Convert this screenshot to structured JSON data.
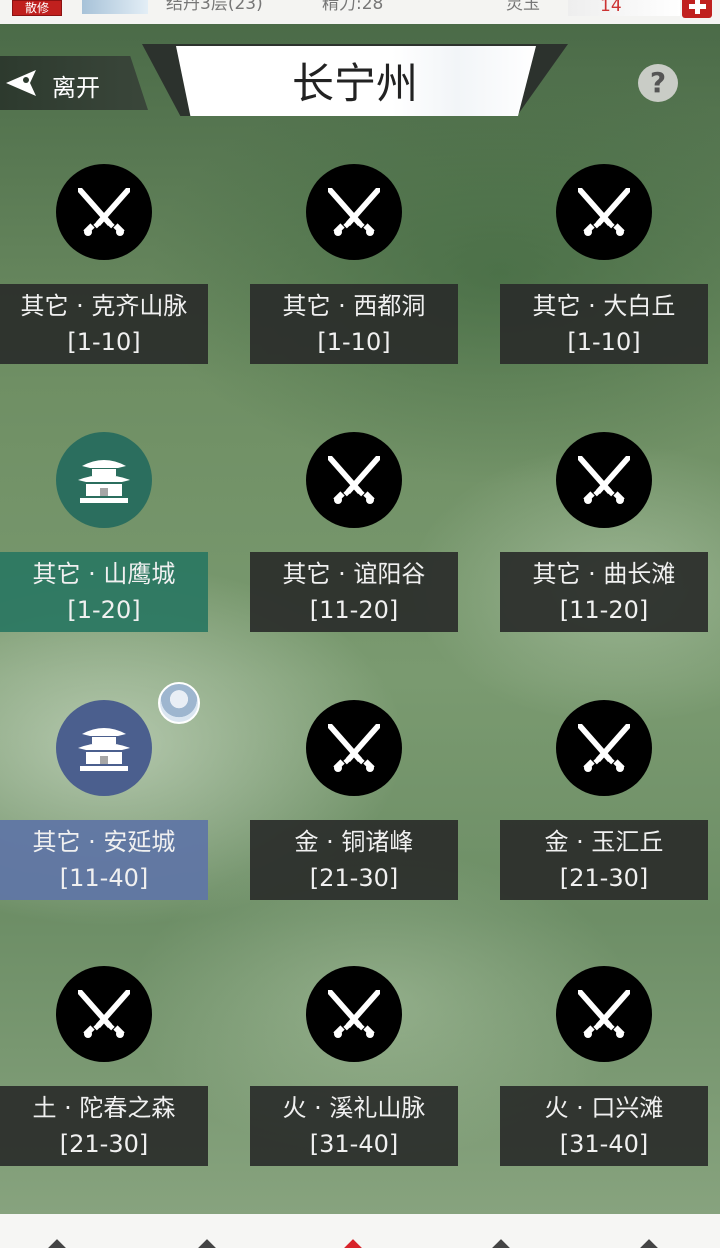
{
  "topbar": {
    "rank": "散修",
    "cultivation": "结丹3层(23)",
    "stamina": "精力:28",
    "jade_label": "灵玉",
    "jade_value": "14"
  },
  "header": {
    "leave_label": "离开",
    "title": "长宁州",
    "help": "?"
  },
  "locations": [
    {
      "name": "其它 · 克齐山脉",
      "range": "[1-10]",
      "type": "battle"
    },
    {
      "name": "其它 · 西都洞",
      "range": "[1-10]",
      "type": "battle"
    },
    {
      "name": "其它 · 大白丘",
      "range": "[1-10]",
      "type": "battle"
    },
    {
      "name": "其它 · 山鹰城",
      "range": "[1-20]",
      "type": "city-green"
    },
    {
      "name": "其它 · 谊阳谷",
      "range": "[11-20]",
      "type": "battle"
    },
    {
      "name": "其它 · 曲长滩",
      "range": "[11-20]",
      "type": "battle"
    },
    {
      "name": "其它 · 安延城",
      "range": "[11-40]",
      "type": "city-blue"
    },
    {
      "name": "金 · 铜诸峰",
      "range": "[21-30]",
      "type": "battle"
    },
    {
      "name": "金 · 玉汇丘",
      "range": "[21-30]",
      "type": "battle"
    },
    {
      "name": "土 · 陀春之森",
      "range": "[21-30]",
      "type": "battle"
    },
    {
      "name": "火 · 溪礼山脉",
      "range": "[31-40]",
      "type": "battle"
    },
    {
      "name": "火 · 口兴滩",
      "range": "[31-40]",
      "type": "battle"
    }
  ],
  "icons": {
    "battle": "crossed-swords-icon",
    "city": "pagoda-city-icon",
    "leave": "back-arrow-icon",
    "help": "question-icon"
  },
  "colors": {
    "accent_red": "#c0201e",
    "city_green": "#2b6e5e",
    "city_blue": "#4b5f8e"
  }
}
